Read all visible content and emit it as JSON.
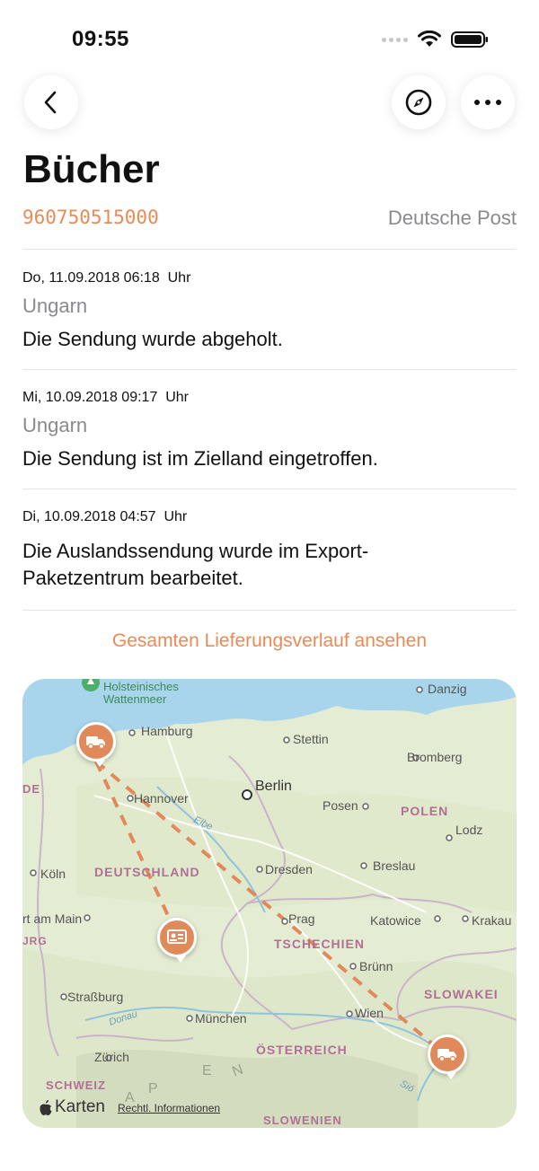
{
  "status_bar": {
    "time": "09:55"
  },
  "nav": {
    "back_icon": "chevron-left-icon",
    "compass_icon": "compass-icon",
    "more_icon": "ellipsis-icon"
  },
  "shipment": {
    "title": "Bücher",
    "tracking_number": "960750515000",
    "carrier": "Deutsche Post"
  },
  "events": [
    {
      "date": "Do, 11.09.2018 06:18  Uhr",
      "location": "Ungarn",
      "description": "Die Sendung wurde abgeholt."
    },
    {
      "date": "Mi, 10.09.2018 09:17  Uhr",
      "location": "Ungarn",
      "description": "Die Sendung ist im Zielland eingetroffen."
    },
    {
      "date": "Di, 10.09.2018 04:57  Uhr",
      "location": "",
      "description": "Die Auslandssendung wurde im Export-\nPaketzentrum bearbeitet."
    }
  ],
  "history_link": "Gesamten Lieferungsverlauf ansehen",
  "map": {
    "countries": [
      "DEUTSCHLAND",
      "POLEN",
      "TSCHECHIEN",
      "ÖSTERREICH",
      "SLOWAKEI",
      "SCHWEIZ",
      "SLOWENIEN"
    ],
    "cities": [
      "Hamburg",
      "Stettin",
      "Danzig",
      "Bromberg",
      "Hannover",
      "Berlin",
      "Posen",
      "Lodz",
      "Köln",
      "Dresden",
      "Breslau",
      "Prag",
      "Katowice",
      "Krakau",
      "Brünn",
      "Straßburg",
      "München",
      "Wien",
      "Zürich"
    ],
    "partial_labels": [
      "DE",
      "rt am Main",
      "JRG"
    ],
    "alps_letters": [
      "A",
      "P",
      "E",
      "N"
    ],
    "rivers": [
      "Elbe",
      "Donau",
      "Sió"
    ],
    "park": "Holsteinisches\nWattenmeer",
    "brand": "Karten",
    "legal": "Rechtl. Informationen",
    "accent_color": "#e08a5c",
    "pins": [
      "truck-icon",
      "customs-icon",
      "truck-icon"
    ]
  },
  "colors": {
    "accent": "#ea8a55",
    "secondary_text": "#8a8a8e"
  }
}
